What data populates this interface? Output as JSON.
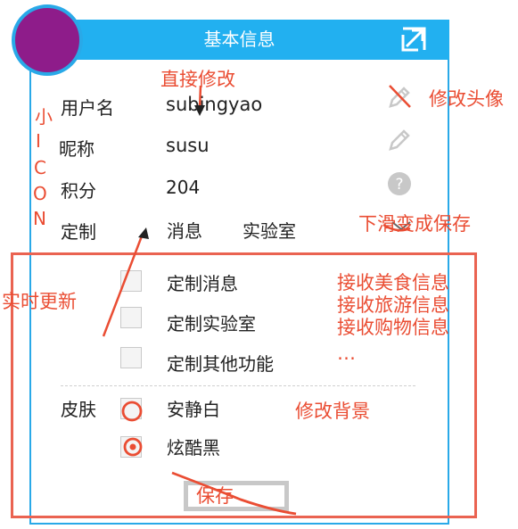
{
  "header": {
    "title": "基本信息"
  },
  "profile": {
    "username_label": "用户名",
    "username_value": "subingyao",
    "nickname_label": "昵称",
    "nickname_value": "susu",
    "points_label": "积分",
    "points_value": "204",
    "custom_label": "定制",
    "custom_tab_1": "消息",
    "custom_tab_2": "实验室"
  },
  "custom_options": [
    {
      "label": "定制消息",
      "checked": false
    },
    {
      "label": "定制实验室",
      "checked": false
    },
    {
      "label": "定制其他功能",
      "checked": false
    }
  ],
  "skin": {
    "label": "皮肤",
    "options": [
      {
        "label": "安静白",
        "selected": false
      },
      {
        "label": "炫酷黑",
        "selected": true
      }
    ]
  },
  "save_label": "保存",
  "annotations": {
    "direct_edit": "直接修改",
    "small_icon_letters": [
      "小",
      "I",
      "C",
      "O",
      "N"
    ],
    "edit_avatar": "修改头像",
    "slide_to_save": "下滑变成保存",
    "realtime_update": "实时更新",
    "receive_food": "接收美食信息",
    "receive_travel": "接收旅游信息",
    "receive_shopping": "接收购物信息",
    "ellipsis": "…",
    "change_background": "修改背景"
  },
  "colors": {
    "header": "#22b0f0",
    "panel_border": "#29a9e8",
    "avatar": "#8e1c8a",
    "annotation": "#ea4d33",
    "annotation_box": "#ea6351"
  },
  "icons": [
    "expand-icon",
    "pencil-icon",
    "help-icon",
    "chevron-down-icon",
    "radio-icon",
    "arrow-icon"
  ]
}
